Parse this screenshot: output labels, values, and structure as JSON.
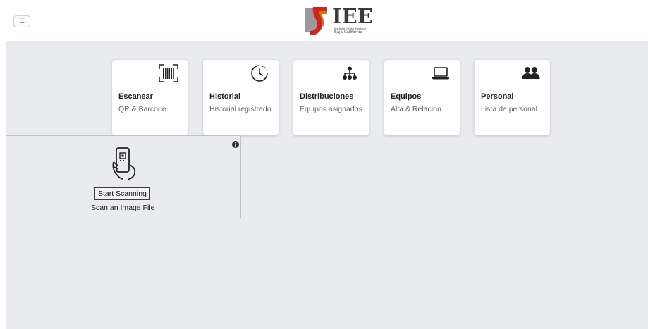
{
  "header": {
    "menu_icon": "hamburger-icon",
    "logo": {
      "title": "IEE",
      "subtitle_line1": "Instituto Estatal Electoral",
      "subtitle_line2": "Baja California"
    }
  },
  "cards": [
    {
      "icon": "barcode-scan-icon",
      "title": "Escanear",
      "description": "QR & Barcode"
    },
    {
      "icon": "clock-history-icon",
      "title": "Historial",
      "description": "Historial registrado"
    },
    {
      "icon": "sitemap-icon",
      "title": "Distribuciones",
      "description": "Equipos asignados"
    },
    {
      "icon": "laptop-icon",
      "title": "Equipos",
      "description": "Alta & Relacion"
    },
    {
      "icon": "users-icon",
      "title": "Personal",
      "description": "Lista de personal"
    }
  ],
  "scanner": {
    "info_icon": "info-icon",
    "phone_icon": "phone-qr-scan-icon",
    "start_label": "Start Scanning",
    "file_label": "Scan an Image File"
  },
  "colors": {
    "background": "#e9ebee",
    "card": "#ffffff",
    "logo_red": "#c0392b",
    "logo_orange": "#e67e22"
  }
}
